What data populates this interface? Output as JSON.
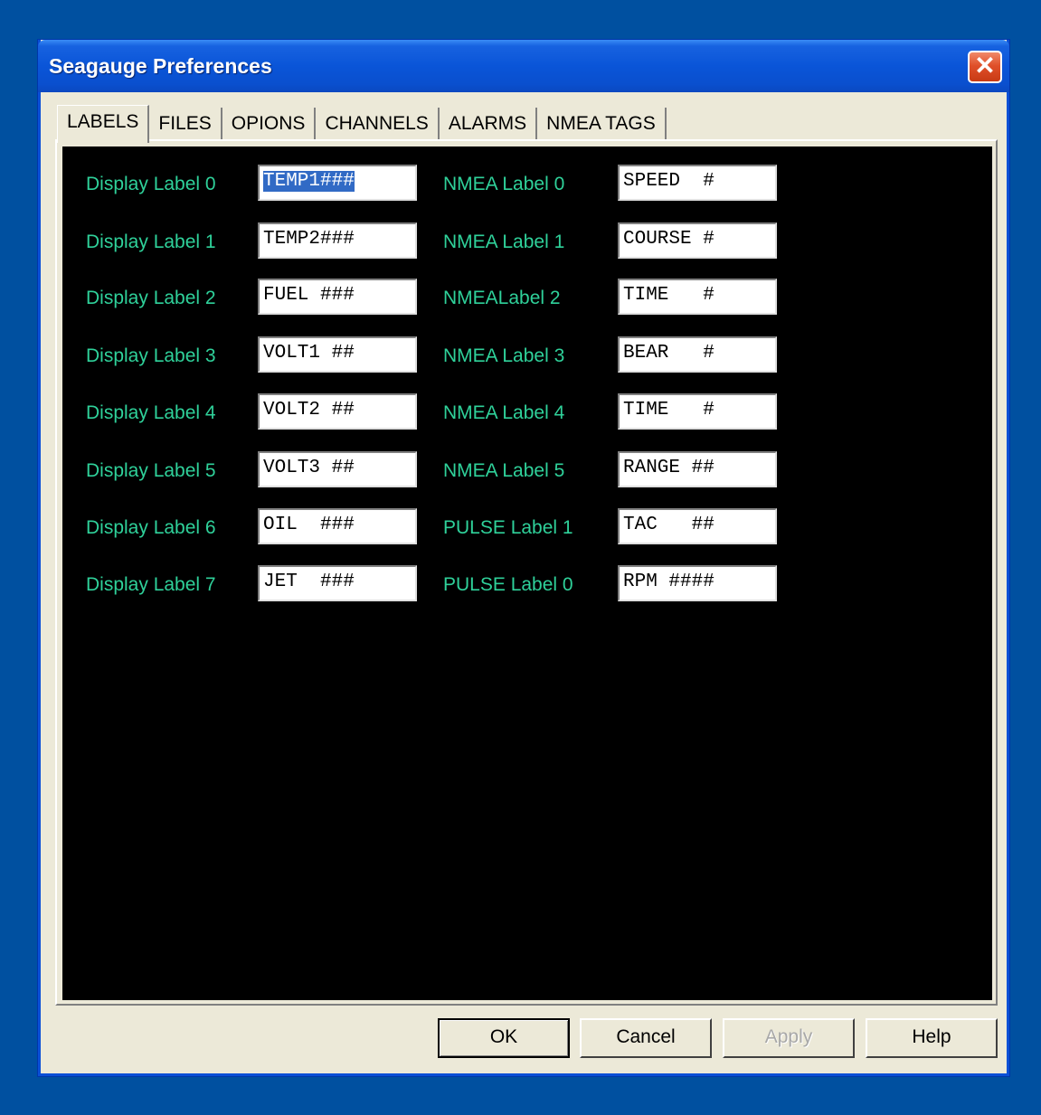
{
  "window": {
    "title": "Seagauge Preferences"
  },
  "tabs": [
    "LABELS",
    "FILES",
    "OPIONS",
    "CHANNELS",
    "ALARMS",
    "NMEA TAGS"
  ],
  "left_labels": [
    "Display Label 0",
    "Display Label 1",
    "Display Label 2",
    "Display Label 3",
    "Display Label 4",
    "Display Label 5",
    "Display Label 6",
    "Display Label 7"
  ],
  "left_values": [
    "TEMP1###",
    "TEMP2###",
    "FUEL ###",
    "VOLT1 ##",
    "VOLT2 ##",
    "VOLT3 ##",
    "OIL  ###",
    "JET  ###"
  ],
  "right_labels": [
    "NMEA Label 0",
    "NMEA Label 1",
    "NMEALabel 2",
    "NMEA Label 3",
    "NMEA Label 4",
    "NMEA Label 5",
    "PULSE Label 1",
    "PULSE Label 0"
  ],
  "right_values": [
    "SPEED  #",
    "COURSE #",
    "TIME   #",
    "BEAR   #",
    "TIME   #",
    "RANGE ##",
    "TAC   ##",
    "RPM ####"
  ],
  "buttons": {
    "ok": "OK",
    "cancel": "Cancel",
    "apply": "Apply",
    "help": "Help"
  },
  "colors": {
    "label_text": "#2fd19a",
    "panel_bg": "#000000",
    "desktop": "#0050a0",
    "selection": "#316ac5"
  }
}
